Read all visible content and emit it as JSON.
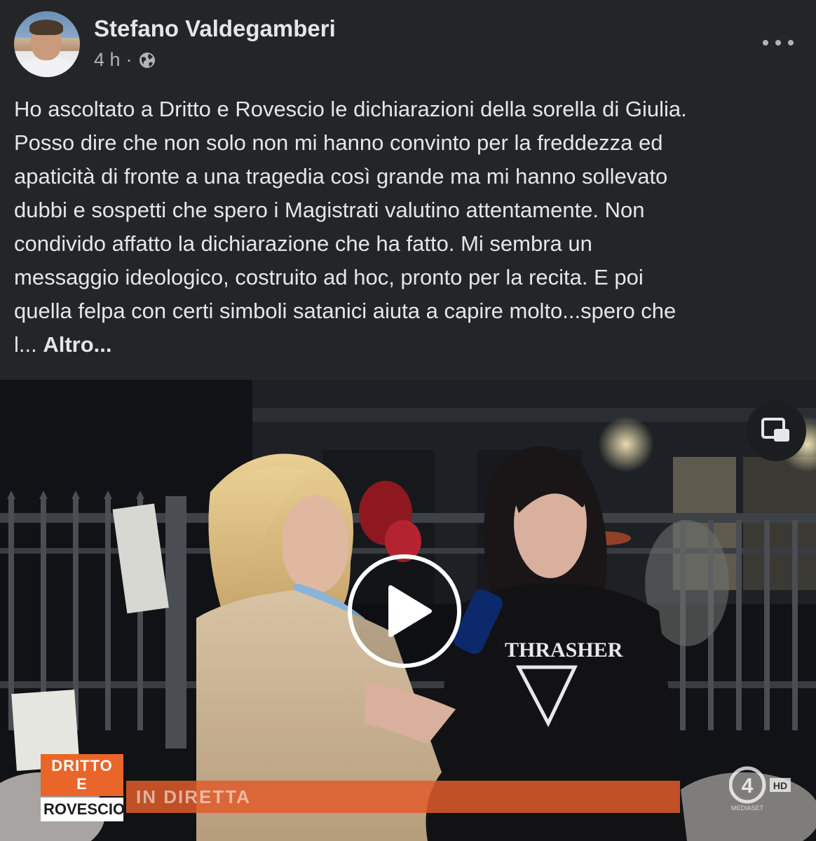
{
  "post": {
    "author": "Stefano Valdegamberi",
    "time": "4 h",
    "separator": "·",
    "text": "Ho ascoltato a Dritto e Rovescio le dichiarazioni della sorella di Giulia.\nPosso dire che non solo non mi hanno convinto per la freddezza ed\napaticità di fronte a una tragedia così grande ma mi hanno sollevato\ndubbi e sospetti che spero i Magistrati valutino attentamente. Non\ncondivido affatto la dichiarazione che ha fatto.  Mi sembra un\nmessaggio ideologico, costruito ad hoc, pronto per la recita. E poi\nquella felpa con certi simboli satanici aiuta a capire molto...spero che\nl... ",
    "see_more": "Altro..."
  },
  "video": {
    "logo_line1": "DRITTO E",
    "logo_line2": "ROVESCIO",
    "banner_text": "IN DIRETTA",
    "channel": "4",
    "channel_hd": "HD",
    "channel_brand": "MEDIASET",
    "sweatshirt_text": "THRASHER"
  },
  "icons": {
    "privacy": "globe-icon",
    "menu": "more-options-icon",
    "pip": "picture-in-picture-icon",
    "play": "play-icon"
  },
  "colors": {
    "background": "#242526",
    "text_primary": "#e4e6eb",
    "text_secondary": "#b0b3b8",
    "banner": "#e05c2a"
  }
}
